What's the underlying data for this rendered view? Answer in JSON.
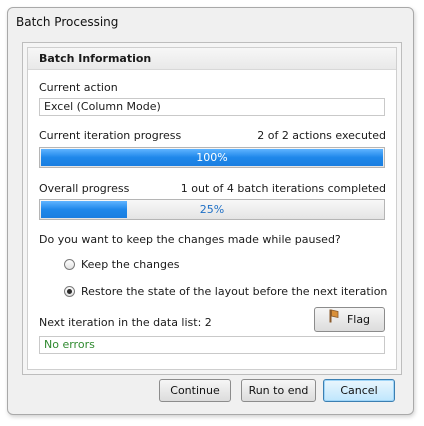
{
  "window": {
    "title": "Batch Processing"
  },
  "group": {
    "title": "Batch Information"
  },
  "current_action": {
    "label": "Current action",
    "value": "Excel (Column Mode)"
  },
  "iteration_progress": {
    "label": "Current iteration progress",
    "summary": "2 of 2 actions executed",
    "percent_text": "100%",
    "fraction": 1.0
  },
  "overall_progress": {
    "label": "Overall progress",
    "summary": "1 out of 4 batch iterations completed",
    "percent_text": "25%",
    "fraction": 0.25
  },
  "paused_changes": {
    "question": "Do you want to keep the changes made while paused?",
    "options": [
      {
        "label": "Keep the changes",
        "selected": false
      },
      {
        "label": "Restore the state of the layout before the next iteration",
        "selected": true
      }
    ]
  },
  "next_iteration": {
    "label": "Next iteration in the data list: 2"
  },
  "flag_button": {
    "label": "Flag",
    "icon": "flag-icon"
  },
  "status": {
    "text": "No errors",
    "color": "#2f8a2f"
  },
  "buttons": {
    "continue": "Continue",
    "run_to_end": "Run to end",
    "cancel": "Cancel"
  },
  "colors": {
    "progress_fill": "#1e87ea",
    "accent": "#3c7fb1"
  }
}
